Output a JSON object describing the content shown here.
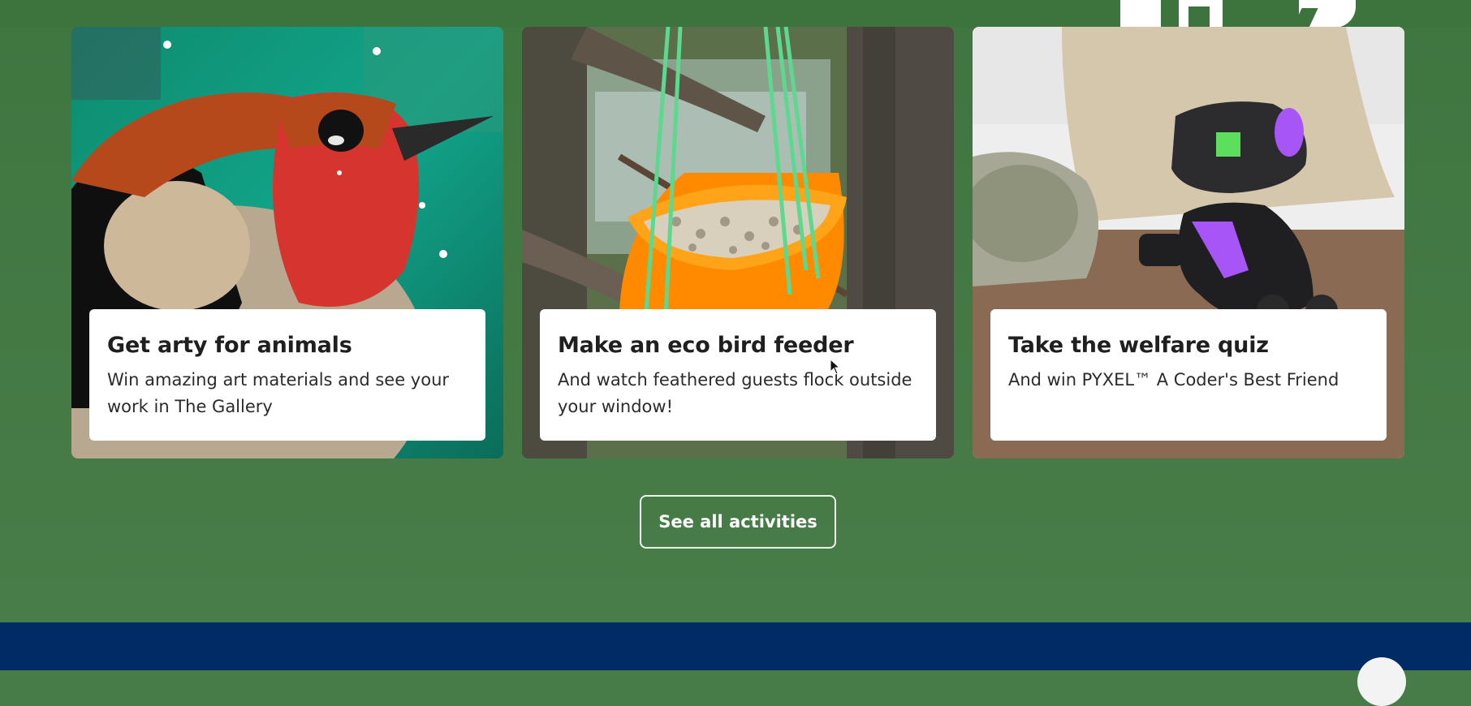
{
  "cards": [
    {
      "title": "Get arty for animals",
      "description": "Win amazing art materials and see your work in The Gallery",
      "image": "painted-robin-bird"
    },
    {
      "title": "Make an eco bird feeder",
      "description": "And watch feathered guests flock outside your window!",
      "image": "orange-peel-bird-feeder"
    },
    {
      "title": "Take the welfare quiz",
      "description": "And win PYXEL™ A Coder's Best Friend",
      "image": "pyxel-robot-dog"
    }
  ],
  "cta": {
    "label": "See all activities"
  },
  "colors": {
    "section_background": "#477b47",
    "footer_background": "#002b64",
    "card_box": "#ffffff"
  }
}
